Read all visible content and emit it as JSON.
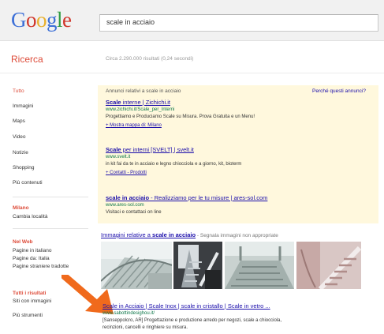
{
  "logo": {
    "letters": [
      "G",
      "o",
      "o",
      "g",
      "l",
      "e"
    ],
    "colors": [
      "#3c6fd7",
      "#d0352a",
      "#e8b12f",
      "#3c6fd7",
      "#2f9b43",
      "#d0352a"
    ]
  },
  "search": {
    "query": "scale in acciaio"
  },
  "header": {
    "ricerca": "Ricerca",
    "stats": "Circa 2.290.000 risultati (0,24 secondi)"
  },
  "sidebar": {
    "items": [
      "Tutto",
      "Immagini",
      "Maps",
      "Video",
      "Notizie",
      "Shopping",
      "Più contenuti"
    ],
    "location_heading": "Milano",
    "location_change": "Cambia località",
    "web_heading": "Nel Web",
    "web_items": [
      "Pagine in italiano",
      "Pagine da: Italia",
      "Pagine straniere tradotte"
    ],
    "results_heading": "Tutti i risultati",
    "results_items": [
      "Siti con immagini",
      "Più strumenti"
    ]
  },
  "ads": {
    "label": "Annunci relativi a scale in acciaio",
    "why": "Perché questi annunci?",
    "items": [
      {
        "title_bold": "Scale",
        "title_rest": " interne | Zichichi.it",
        "url": "www.zichichi.it/Scale_per_Interni",
        "desc": "Progettiamo e Produciamo Scale su Misura. Prova Gratuita e un Menu!",
        "sitelink": "Mostra mappa di: Milano"
      },
      {
        "title_bold": "Scale",
        "title_rest": " per interni [SVELT] | svelt.it",
        "url": "www.svelt.it",
        "desc": "in kit fai da te in acciaio e legno chiocciola e a giorno, kit, bioterm",
        "sitelink": "Contatti - Prodotti"
      },
      {
        "title_bold": "scale in acciaio",
        "title_rest": " - Realizziamo per le tu misure | ares-sol.com",
        "url": "www.ares-sol.com",
        "desc": "Visitaci e contattaci on line"
      }
    ]
  },
  "images": {
    "title_pre": "Immagini relative a ",
    "title_bold": "scale in acciaio",
    "title_gray": " - Segnala immagini non appropriate"
  },
  "result": {
    "title": "Scale in Acciaio | Scale Inox | scale in cristallo | Scale in vetro ...",
    "url": "www.sabottindesighou.it/",
    "desc1": "[Sanseppolcro, AR] Progettazione e produzione arredo per negozi, scale a chiocciola,",
    "desc2": "recinzioni, cancelli e ringhiere su misura."
  },
  "colors": {
    "accent_red": "#dd4b39",
    "link_blue": "#1a0dab",
    "url_green": "#0e774a",
    "ad_bg": "#fff8dd",
    "arrow": "#f06a1c"
  }
}
